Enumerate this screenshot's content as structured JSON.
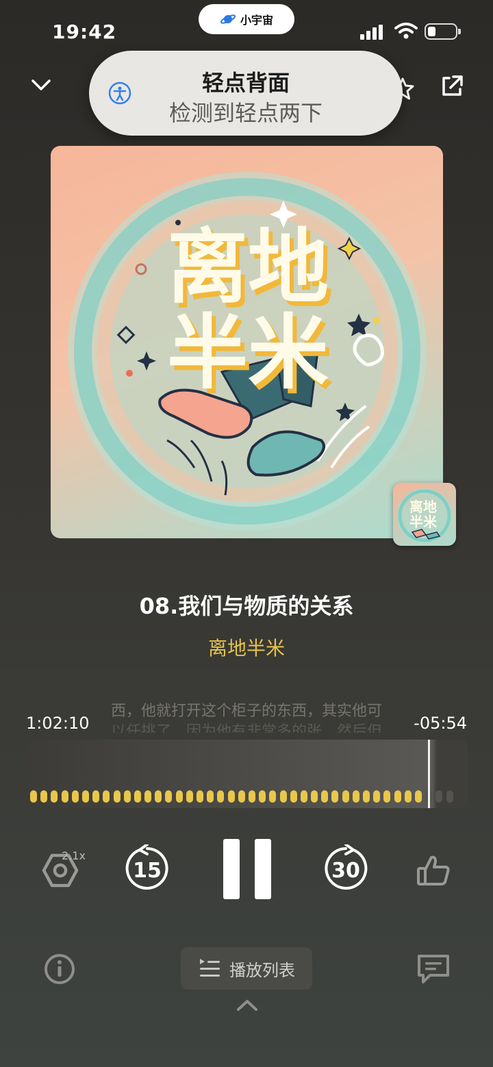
{
  "status_bar": {
    "time": "19:42",
    "island_label": "小宇宙"
  },
  "banner": {
    "title": "轻点背面",
    "subtitle": "检测到轻点两下",
    "icon": "accessibility-icon"
  },
  "header": {
    "left_icon": "chevron-down-icon",
    "right_icons": [
      "star-icon",
      "share-icon"
    ]
  },
  "cover": {
    "text_line1": "离地",
    "text_line2": "半米"
  },
  "episode": {
    "title": "08.我们与物质的关系",
    "podcast": "离地半米"
  },
  "transcript": {
    "line1": "西，他就打开这个柜子的东西，其实他可",
    "line2": "以任挑了，因为他有非常多的张，然后但"
  },
  "progress": {
    "elapsed": "1:02:10",
    "remaining": "-05:54",
    "fraction_played": 0.92
  },
  "controls": {
    "speed": "2.1x",
    "rewind": "15",
    "forward": "30",
    "state": "playing"
  },
  "bottom": {
    "playlist_label": "播放列表"
  },
  "colors": {
    "accent": "#e8c74a",
    "background": "#33312e"
  }
}
